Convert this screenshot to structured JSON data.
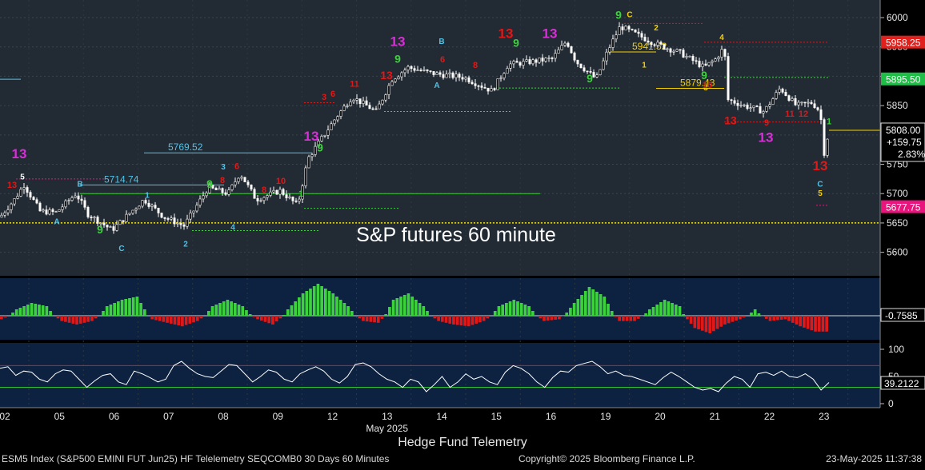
{
  "overlay_title": "S&P futures 60 minute",
  "caption": "Hedge Fund Telemetry",
  "footer": {
    "left": "ESM5 Index (S&P500 EMINI FUT  Jun25) HF Telelemetry SEQCOMB0 30 Days 60 Minutes",
    "center": "Copyright© 2025 Bloomberg Finance L.P.",
    "right": "23-May-2025 11:37:38"
  },
  "colors": {
    "bg_top": "#222a33",
    "bg_sub": "#0d2240",
    "candle": "#ffffff",
    "hist_pos": "#3cd23c",
    "hist_neg": "#e01818",
    "tag_magenta": "#e8157c",
    "tag_red": "#e0201c",
    "tag_green": "#1fbf47",
    "tag_white": "#ffffff"
  },
  "chart_data": [
    {
      "type": "candlestick",
      "name": "price",
      "ylim": [
        5560,
        6030
      ],
      "yticks": [
        5600,
        5650,
        5700,
        5750,
        5800,
        5850,
        5900,
        5950,
        6000
      ],
      "x_categories": [
        "02",
        "05",
        "06",
        "07",
        "08",
        "09",
        "12",
        "13",
        "14",
        "15",
        "16",
        "19",
        "20",
        "21",
        "22",
        "23"
      ],
      "x_month_label": "May 2025",
      "x_month_under": "13",
      "anchors": [
        {
          "x": 0,
          "y": 5660
        },
        {
          "x": 18,
          "y": 5690
        },
        {
          "x": 30,
          "y": 5715
        },
        {
          "x": 50,
          "y": 5670
        },
        {
          "x": 70,
          "y": 5668
        },
        {
          "x": 95,
          "y": 5700
        },
        {
          "x": 110,
          "y": 5665
        },
        {
          "x": 140,
          "y": 5638
        },
        {
          "x": 180,
          "y": 5690
        },
        {
          "x": 205,
          "y": 5660
        },
        {
          "x": 230,
          "y": 5645
        },
        {
          "x": 260,
          "y": 5710
        },
        {
          "x": 285,
          "y": 5700
        },
        {
          "x": 300,
          "y": 5735
        },
        {
          "x": 320,
          "y": 5690
        },
        {
          "x": 350,
          "y": 5705
        },
        {
          "x": 372,
          "y": 5680
        },
        {
          "x": 385,
          "y": 5760
        },
        {
          "x": 400,
          "y": 5790
        },
        {
          "x": 420,
          "y": 5830
        },
        {
          "x": 440,
          "y": 5865
        },
        {
          "x": 470,
          "y": 5840
        },
        {
          "x": 490,
          "y": 5895
        },
        {
          "x": 510,
          "y": 5915
        },
        {
          "x": 540,
          "y": 5905
        },
        {
          "x": 580,
          "y": 5898
        },
        {
          "x": 615,
          "y": 5875
        },
        {
          "x": 635,
          "y": 5920
        },
        {
          "x": 665,
          "y": 5925
        },
        {
          "x": 690,
          "y": 5930
        },
        {
          "x": 708,
          "y": 5960
        },
        {
          "x": 720,
          "y": 5925
        },
        {
          "x": 745,
          "y": 5895
        },
        {
          "x": 760,
          "y": 5945
        },
        {
          "x": 775,
          "y": 5985
        },
        {
          "x": 790,
          "y": 5975
        },
        {
          "x": 820,
          "y": 5955
        },
        {
          "x": 850,
          "y": 5940
        },
        {
          "x": 880,
          "y": 5915
        },
        {
          "x": 895,
          "y": 5930
        },
        {
          "x": 905,
          "y": 5950
        },
        {
          "x": 910,
          "y": 5860
        },
        {
          "x": 930,
          "y": 5850
        },
        {
          "x": 955,
          "y": 5840
        },
        {
          "x": 975,
          "y": 5880
        },
        {
          "x": 995,
          "y": 5850
        },
        {
          "x": 1015,
          "y": 5855
        },
        {
          "x": 1025,
          "y": 5840
        },
        {
          "x": 1030,
          "y": 5770
        },
        {
          "x": 1036,
          "y": 5808
        }
      ],
      "levels": [
        {
          "label": "5714.74",
          "value": 5714.74,
          "x0": 100,
          "x1": 280,
          "color": "#4fc3e8"
        },
        {
          "label": "5769.52",
          "value": 5769.52,
          "x0": 180,
          "x1": 390,
          "color": "#4fc3e8"
        },
        {
          "label": "5941.52",
          "value": 5941.52,
          "x0": 760,
          "x1": 820,
          "color": "#f5d000"
        },
        {
          "label": "5879.43",
          "value": 5879.43,
          "x0": 820,
          "x1": 905,
          "color": "#f5d000"
        }
      ],
      "hlines": [
        {
          "value": 5700,
          "x0": 100,
          "x1": 675,
          "color": "#3cd23c",
          "style": "solid"
        },
        {
          "value": 5675,
          "x0": 380,
          "x1": 500,
          "color": "#3cd23c",
          "style": "dotted"
        },
        {
          "value": 5637,
          "x0": 240,
          "x1": 400,
          "color": "#3cd23c",
          "style": "dotted"
        },
        {
          "value": 5840,
          "x0": 480,
          "x1": 640,
          "color": "#3cd23c",
          "style": "dotted"
        },
        {
          "value": 5880,
          "x0": 620,
          "x1": 775,
          "color": "#3cd23c",
          "style": "dotted"
        },
        {
          "value": 5898,
          "x0": 905,
          "x1": 1035,
          "color": "#3cd23c",
          "style": "dotted"
        },
        {
          "value": 5958,
          "x0": 880,
          "x1": 1035,
          "color": "#e01818",
          "style": "dotted"
        },
        {
          "value": 5990,
          "x0": 780,
          "x1": 880,
          "color": "#e01818",
          "style": "dotted"
        },
        {
          "value": 5855,
          "x0": 380,
          "x1": 420,
          "color": "#e01818",
          "style": "dotted"
        },
        {
          "value": 5822,
          "x0": 905,
          "x1": 1025,
          "color": "#e01818",
          "style": "dotted"
        },
        {
          "value": 5725,
          "x0": 20,
          "x1": 130,
          "color": "#e8157c",
          "style": "dotted"
        },
        {
          "value": 5680,
          "x0": 1020,
          "x1": 1035,
          "color": "#e8157c",
          "style": "dotted"
        },
        {
          "value": 5808,
          "x0": 1036,
          "x1": 1100,
          "color": "#f5d000",
          "style": "solid"
        },
        {
          "value": 5895,
          "x0": 0,
          "x1": 26,
          "color": "#4fc3e8",
          "style": "solid"
        }
      ],
      "baseline": {
        "value": 5650,
        "color": "#f5e000"
      },
      "last": {
        "value": "5808.00",
        "change": "+159.75",
        "pct": "2.83%"
      },
      "right_tags": [
        {
          "label": "5958.25",
          "value": 5958.25,
          "color": "#e0201c",
          "text": "#ffffff"
        },
        {
          "label": "5895.50",
          "value": 5895.5,
          "color": "#1fbf47",
          "text": "#ffffff"
        },
        {
          "label": "5677.75",
          "value": 5677.75,
          "color": "#e8157c",
          "text": "#ffffff"
        }
      ],
      "annotations": [
        {
          "t": "13",
          "x": 24,
          "y": 5760,
          "c": "#d82fd8",
          "s": 17
        },
        {
          "t": "5",
          "x": 28,
          "y": 5724,
          "c": "#ffffff",
          "s": 10
        },
        {
          "t": "13",
          "x": 15,
          "y": 5710,
          "c": "#e01818",
          "s": 11
        },
        {
          "t": "B",
          "x": 100,
          "y": 5712,
          "c": "#4fc3e8",
          "s": 10
        },
        {
          "t": "A",
          "x": 71,
          "y": 5648,
          "c": "#4fc3e8",
          "s": 10
        },
        {
          "t": "9",
          "x": 125,
          "y": 5632,
          "c": "#3cd23c",
          "s": 14
        },
        {
          "t": "C",
          "x": 152,
          "y": 5602,
          "c": "#4fc3e8",
          "s": 10
        },
        {
          "t": "1",
          "x": 184,
          "y": 5693,
          "c": "#4fc3e8",
          "s": 10
        },
        {
          "t": "2",
          "x": 232,
          "y": 5610,
          "c": "#4fc3e8",
          "s": 10
        },
        {
          "t": "3",
          "x": 279,
          "y": 5741,
          "c": "#4fc3e8",
          "s": 10
        },
        {
          "t": "4",
          "x": 291,
          "y": 5638,
          "c": "#4fc3e8",
          "s": 10
        },
        {
          "t": "9",
          "x": 262,
          "y": 5710,
          "c": "#3cd23c",
          "s": 14
        },
        {
          "t": "8",
          "x": 278,
          "y": 5718,
          "c": "#e01818",
          "s": 11
        },
        {
          "t": "6",
          "x": 296,
          "y": 5742,
          "c": "#e01818",
          "s": 11
        },
        {
          "t": "8",
          "x": 330,
          "y": 5702,
          "c": "#e01818",
          "s": 11
        },
        {
          "t": "10",
          "x": 351,
          "y": 5717,
          "c": "#e01818",
          "s": 11
        },
        {
          "t": "1",
          "x": 376,
          "y": 5695,
          "c": "#3cd23c",
          "s": 11
        },
        {
          "t": "13",
          "x": 389,
          "y": 5790,
          "c": "#d82fd8",
          "s": 17
        },
        {
          "t": "9",
          "x": 400,
          "y": 5772,
          "c": "#3cd23c",
          "s": 14
        },
        {
          "t": "3",
          "x": 405,
          "y": 5860,
          "c": "#e01818",
          "s": 11
        },
        {
          "t": "6",
          "x": 416,
          "y": 5865,
          "c": "#e01818",
          "s": 11
        },
        {
          "t": "11",
          "x": 443,
          "y": 5882,
          "c": "#e01818",
          "s": 11
        },
        {
          "t": "13",
          "x": 483,
          "y": 5895,
          "c": "#e01818",
          "s": 14
        },
        {
          "t": "13",
          "x": 497,
          "y": 5952,
          "c": "#d82fd8",
          "s": 17
        },
        {
          "t": "9",
          "x": 497,
          "y": 5923,
          "c": "#3cd23c",
          "s": 14
        },
        {
          "t": "B",
          "x": 552,
          "y": 5955,
          "c": "#4fc3e8",
          "s": 10
        },
        {
          "t": "A",
          "x": 546,
          "y": 5880,
          "c": "#4fc3e8",
          "s": 10
        },
        {
          "t": "6",
          "x": 553,
          "y": 5924,
          "c": "#e01818",
          "s": 11
        },
        {
          "t": "8",
          "x": 594,
          "y": 5914,
          "c": "#e01818",
          "s": 11
        },
        {
          "t": "13",
          "x": 632,
          "y": 5965,
          "c": "#e01818",
          "s": 17
        },
        {
          "t": "9",
          "x": 645,
          "y": 5950,
          "c": "#3cd23c",
          "s": 14
        },
        {
          "t": "13",
          "x": 687,
          "y": 5965,
          "c": "#d82fd8",
          "s": 17
        },
        {
          "t": "9",
          "x": 737,
          "y": 5890,
          "c": "#3cd23c",
          "s": 14
        },
        {
          "t": "9",
          "x": 773,
          "y": 5998,
          "c": "#3cd23c",
          "s": 14
        },
        {
          "t": "C",
          "x": 787,
          "y": 6001,
          "c": "#f5d000",
          "s": 10
        },
        {
          "t": "2",
          "x": 820,
          "y": 5978,
          "c": "#f5d000",
          "s": 10
        },
        {
          "t": "1",
          "x": 805,
          "y": 5915,
          "c": "#f5d000",
          "s": 10
        },
        {
          "t": "3",
          "x": 882,
          "y": 5876,
          "c": "#f5d000",
          "s": 10
        },
        {
          "t": "4",
          "x": 902,
          "y": 5962,
          "c": "#f5d000",
          "s": 10
        },
        {
          "t": "9",
          "x": 880,
          "y": 5895,
          "c": "#3cd23c",
          "s": 14
        },
        {
          "t": "10",
          "x": 884,
          "y": 5880,
          "c": "#e01818",
          "s": 11
        },
        {
          "t": "13",
          "x": 913,
          "y": 5818,
          "c": "#e01818",
          "s": 14
        },
        {
          "t": "9",
          "x": 958,
          "y": 5816,
          "c": "#e01818",
          "s": 11
        },
        {
          "t": "13",
          "x": 957,
          "y": 5788,
          "c": "#d82fd8",
          "s": 17
        },
        {
          "t": "11",
          "x": 987,
          "y": 5831,
          "c": "#e01818",
          "s": 11
        },
        {
          "t": "12",
          "x": 1004,
          "y": 5831,
          "c": "#e01818",
          "s": 11
        },
        {
          "t": "1",
          "x": 1036,
          "y": 5818,
          "c": "#3cd23c",
          "s": 11
        },
        {
          "t": "13",
          "x": 1025,
          "y": 5740,
          "c": "#e01818",
          "s": 17
        },
        {
          "t": "C",
          "x": 1025,
          "y": 5712,
          "c": "#4fc3e8",
          "s": 10
        },
        {
          "t": "5",
          "x": 1025,
          "y": 5696,
          "c": "#f5d000",
          "s": 10
        }
      ]
    },
    {
      "type": "bar",
      "name": "oscillator",
      "ylim": [
        -1,
        1
      ],
      "last_label": "-0.7585",
      "values": [
        -0.2,
        0.2,
        0.4,
        0.3,
        -0.3,
        -0.5,
        -0.3,
        0.3,
        0.5,
        0.6,
        -0.2,
        -0.4,
        -0.6,
        -0.3,
        0.3,
        0.5,
        0.3,
        -0.2,
        -0.5,
        0.2,
        0.7,
        1.0,
        0.7,
        0.3,
        -0.3,
        -0.4,
        0.5,
        0.7,
        0.3,
        -0.3,
        -0.5,
        -0.6,
        -0.3,
        0.3,
        0.5,
        0.3,
        -0.3,
        -0.2,
        0.4,
        0.9,
        0.6,
        -0.3,
        -0.3,
        0.2,
        0.5,
        0.3,
        -0.7,
        -1.0,
        -0.5,
        -0.2,
        0.2,
        -0.3,
        -0.2,
        -0.6,
        -0.9
      ]
    },
    {
      "type": "line",
      "name": "rsi",
      "ylim": [
        0,
        100
      ],
      "yticks": [
        0,
        50,
        100
      ],
      "overbought": 70,
      "oversold": 30,
      "last_label": "39.2122",
      "values": [
        65,
        68,
        52,
        60,
        58,
        45,
        40,
        55,
        62,
        60,
        45,
        30,
        42,
        52,
        55,
        40,
        35,
        60,
        55,
        48,
        40,
        45,
        70,
        78,
        65,
        55,
        50,
        48,
        60,
        72,
        70,
        55,
        40,
        50,
        62,
        58,
        45,
        40,
        55,
        62,
        68,
        60,
        45,
        38,
        50,
        72,
        75,
        68,
        55,
        45,
        40,
        30,
        45,
        40,
        22,
        35,
        50,
        30,
        40,
        55,
        45,
        50,
        40,
        35,
        58,
        70,
        65,
        55,
        40,
        30,
        48,
        60,
        58,
        70,
        74,
        78,
        68,
        55,
        60,
        52,
        50,
        45,
        40,
        35,
        48,
        58,
        50,
        40,
        30,
        25,
        28,
        22,
        38,
        50,
        45,
        30,
        55,
        58,
        52,
        60,
        50,
        48,
        55,
        45,
        25,
        39
      ]
    }
  ]
}
